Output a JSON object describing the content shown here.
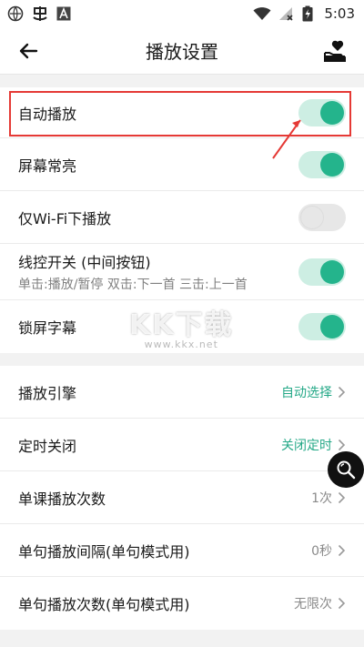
{
  "status_bar": {
    "time": "5:03"
  },
  "header": {
    "title": "播放设置"
  },
  "toggle_rows": [
    {
      "label": "自动播放",
      "on": true
    },
    {
      "label": "屏幕常亮",
      "on": true
    },
    {
      "label": "仅Wi-Fi下播放",
      "on": false
    },
    {
      "label": "线控开关 (中间按钮)",
      "sublabel": "单击:播放/暂停 双击:下一首 三击:上一首",
      "on": true
    },
    {
      "label": "锁屏字幕",
      "on": true
    }
  ],
  "nav_rows": [
    {
      "label": "播放引擎",
      "value": "自动选择",
      "accent": true
    },
    {
      "label": "定时关闭",
      "value": "关闭定时",
      "accent": true
    },
    {
      "label": "单课播放次数",
      "value": "1次",
      "accent": false
    },
    {
      "label": "单句播放间隔(单句模式用)",
      "value": "0秒",
      "accent": false
    },
    {
      "label": "单句播放次数(单句模式用)",
      "value": "无限次",
      "accent": false
    }
  ],
  "watermark": {
    "big": "KK下载",
    "small": "www.kkx.net"
  },
  "colors": {
    "accent": "#24b48c",
    "highlight": "#e53935"
  }
}
